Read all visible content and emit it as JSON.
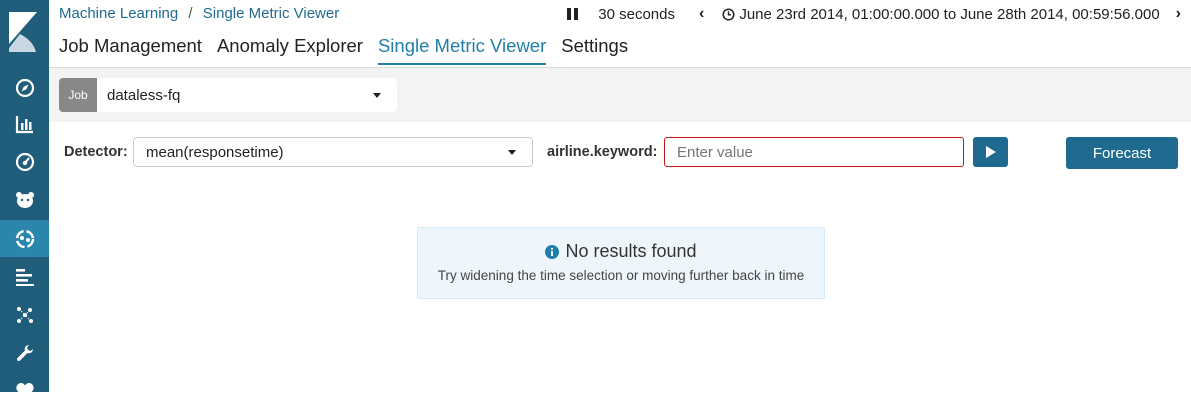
{
  "breadcrumb": {
    "root": "Machine Learning",
    "separator": "/",
    "current": "Single Metric Viewer"
  },
  "timebar": {
    "refresh_interval": "30 seconds",
    "time_range": "June 23rd 2014, 01:00:00.000 to June 28th 2014, 00:59:56.000"
  },
  "tabs": [
    {
      "label": "Job Management",
      "active": false
    },
    {
      "label": "Anomaly Explorer",
      "active": false
    },
    {
      "label": "Single Metric Viewer",
      "active": true
    },
    {
      "label": "Settings",
      "active": false
    }
  ],
  "sidebar": {
    "items": [
      {
        "icon": "compass-icon"
      },
      {
        "icon": "bar-chart-icon"
      },
      {
        "icon": "gauge-icon"
      },
      {
        "icon": "bear-icon"
      },
      {
        "icon": "machine-learning-icon",
        "active": true
      },
      {
        "icon": "apm-icon"
      },
      {
        "icon": "graph-icon"
      },
      {
        "icon": "wrench-icon"
      },
      {
        "icon": "heartbeat-icon"
      }
    ]
  },
  "job": {
    "tag": "Job",
    "selected": "dataless-fq"
  },
  "controls": {
    "detector_label": "Detector:",
    "detector_value": "mean(responsetime)",
    "entity_label": "airline.keyword:",
    "entity_placeholder": "Enter value",
    "forecast_label": "Forecast"
  },
  "no_results": {
    "title": "No results found",
    "message": "Try widening the time selection or moving further back in time"
  },
  "colors": {
    "nav_bg": "#1f5d7b",
    "nav_active": "#2b86ad",
    "accent": "#1f7faa",
    "input_error": "#c4161c"
  }
}
